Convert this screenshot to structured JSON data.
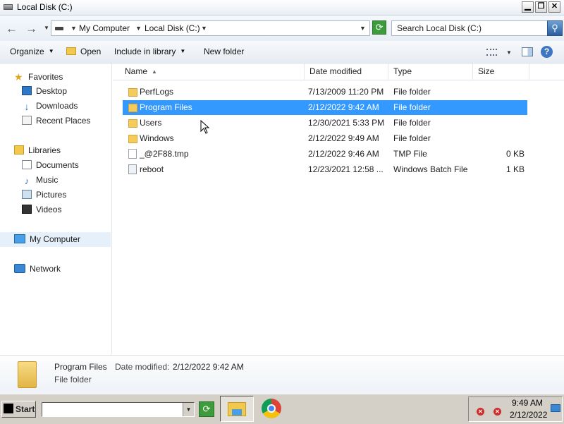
{
  "window": {
    "title": "Local Disk (C:)",
    "controls": {
      "minimize": "▁",
      "maximize": "❐",
      "close": "✕"
    }
  },
  "address_bar": {
    "back_icon": "back-arrow-icon",
    "forward_icon": "forward-arrow-icon",
    "breadcrumbs": [
      "My Computer",
      "Local Disk (C:)"
    ],
    "search_placeholder": "Search Local Disk (C:)"
  },
  "toolbar": {
    "organize": "Organize",
    "open": "Open",
    "include_in_library": "Include in library",
    "new_folder": "New folder"
  },
  "nav": {
    "favorites": {
      "label": "Favorites",
      "items": [
        "Desktop",
        "Downloads",
        "Recent Places"
      ]
    },
    "libraries": {
      "label": "Libraries",
      "items": [
        "Documents",
        "Music",
        "Pictures",
        "Videos"
      ]
    },
    "computer": "My Computer",
    "network": "Network"
  },
  "columns": {
    "name": "Name",
    "date_modified": "Date modified",
    "type": "Type",
    "size": "Size"
  },
  "files": [
    {
      "name": "PerfLogs",
      "date": "7/13/2009 11:20 PM",
      "type": "File folder",
      "size": "",
      "icon": "folder-icon"
    },
    {
      "name": "Program Files",
      "date": "2/12/2022 9:42 AM",
      "type": "File folder",
      "size": "",
      "icon": "folder-icon",
      "selected": true
    },
    {
      "name": "Users",
      "date": "12/30/2021 5:33 PM",
      "type": "File folder",
      "size": "",
      "icon": "folder-icon"
    },
    {
      "name": "Windows",
      "date": "2/12/2022 9:49 AM",
      "type": "File folder",
      "size": "",
      "icon": "folder-icon"
    },
    {
      "name": "_@2F88.tmp",
      "date": "2/12/2022 9:46 AM",
      "type": "TMP File",
      "size": "0 KB",
      "icon": "file-icon"
    },
    {
      "name": "reboot",
      "date": "12/23/2021 12:58 ...",
      "type": "Windows Batch File",
      "size": "1 KB",
      "icon": "batch-file-icon"
    }
  ],
  "details": {
    "name": "Program Files",
    "date_label": "Date modified:",
    "date_value": "2/12/2022 9:42 AM",
    "type": "File folder"
  },
  "taskbar": {
    "start": "Start",
    "run_value": "",
    "clock_time": "9:49 AM",
    "clock_date": "2/12/2022"
  },
  "colors": {
    "selection": "#3399ff",
    "nav_selection": "#e5f0fa",
    "folder": "#f5cc5b",
    "taskbar": "#d4d0c8"
  }
}
